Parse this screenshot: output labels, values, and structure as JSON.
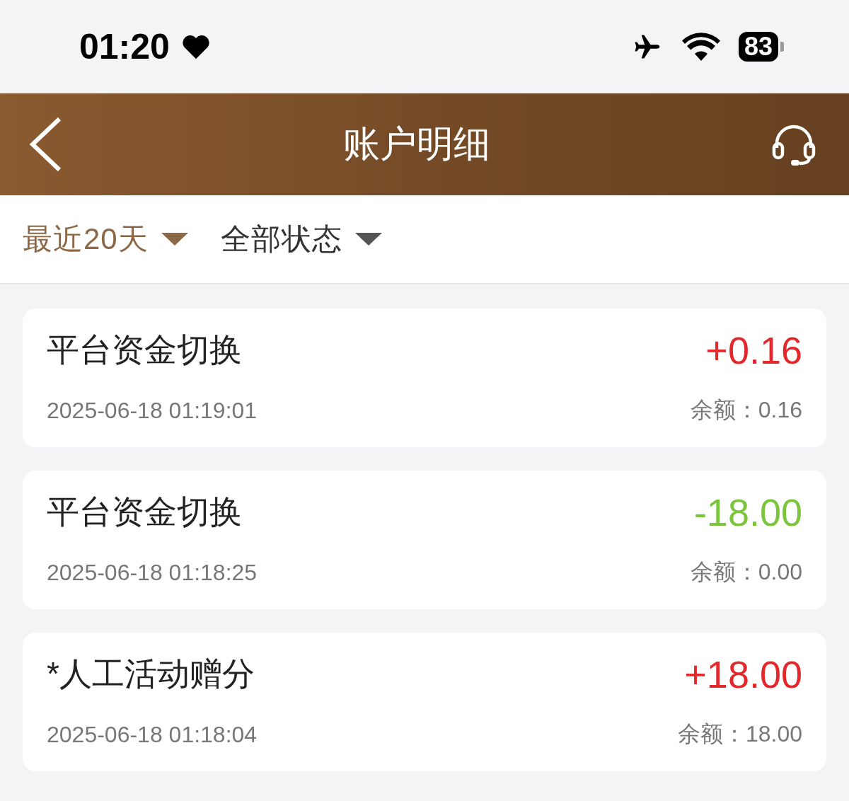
{
  "status_bar": {
    "time": "01:20",
    "battery": "83"
  },
  "header": {
    "title": "账户明细"
  },
  "filters": [
    {
      "label": "最近20天",
      "selected": true
    },
    {
      "label": "全部状态",
      "selected": false
    }
  ],
  "transactions": [
    {
      "title": "平台资金切换",
      "amount": "+0.16",
      "kind": "income",
      "time": "2025-06-18 01:19:01",
      "balance": "余额：0.16"
    },
    {
      "title": "平台资金切换",
      "amount": "-18.00",
      "kind": "expense",
      "time": "2025-06-18 01:18:25",
      "balance": "余额：0.00"
    },
    {
      "title": "*人工活动赠分",
      "amount": "+18.00",
      "kind": "income",
      "time": "2025-06-18 01:18:04",
      "balance": "余额：18.00"
    }
  ]
}
